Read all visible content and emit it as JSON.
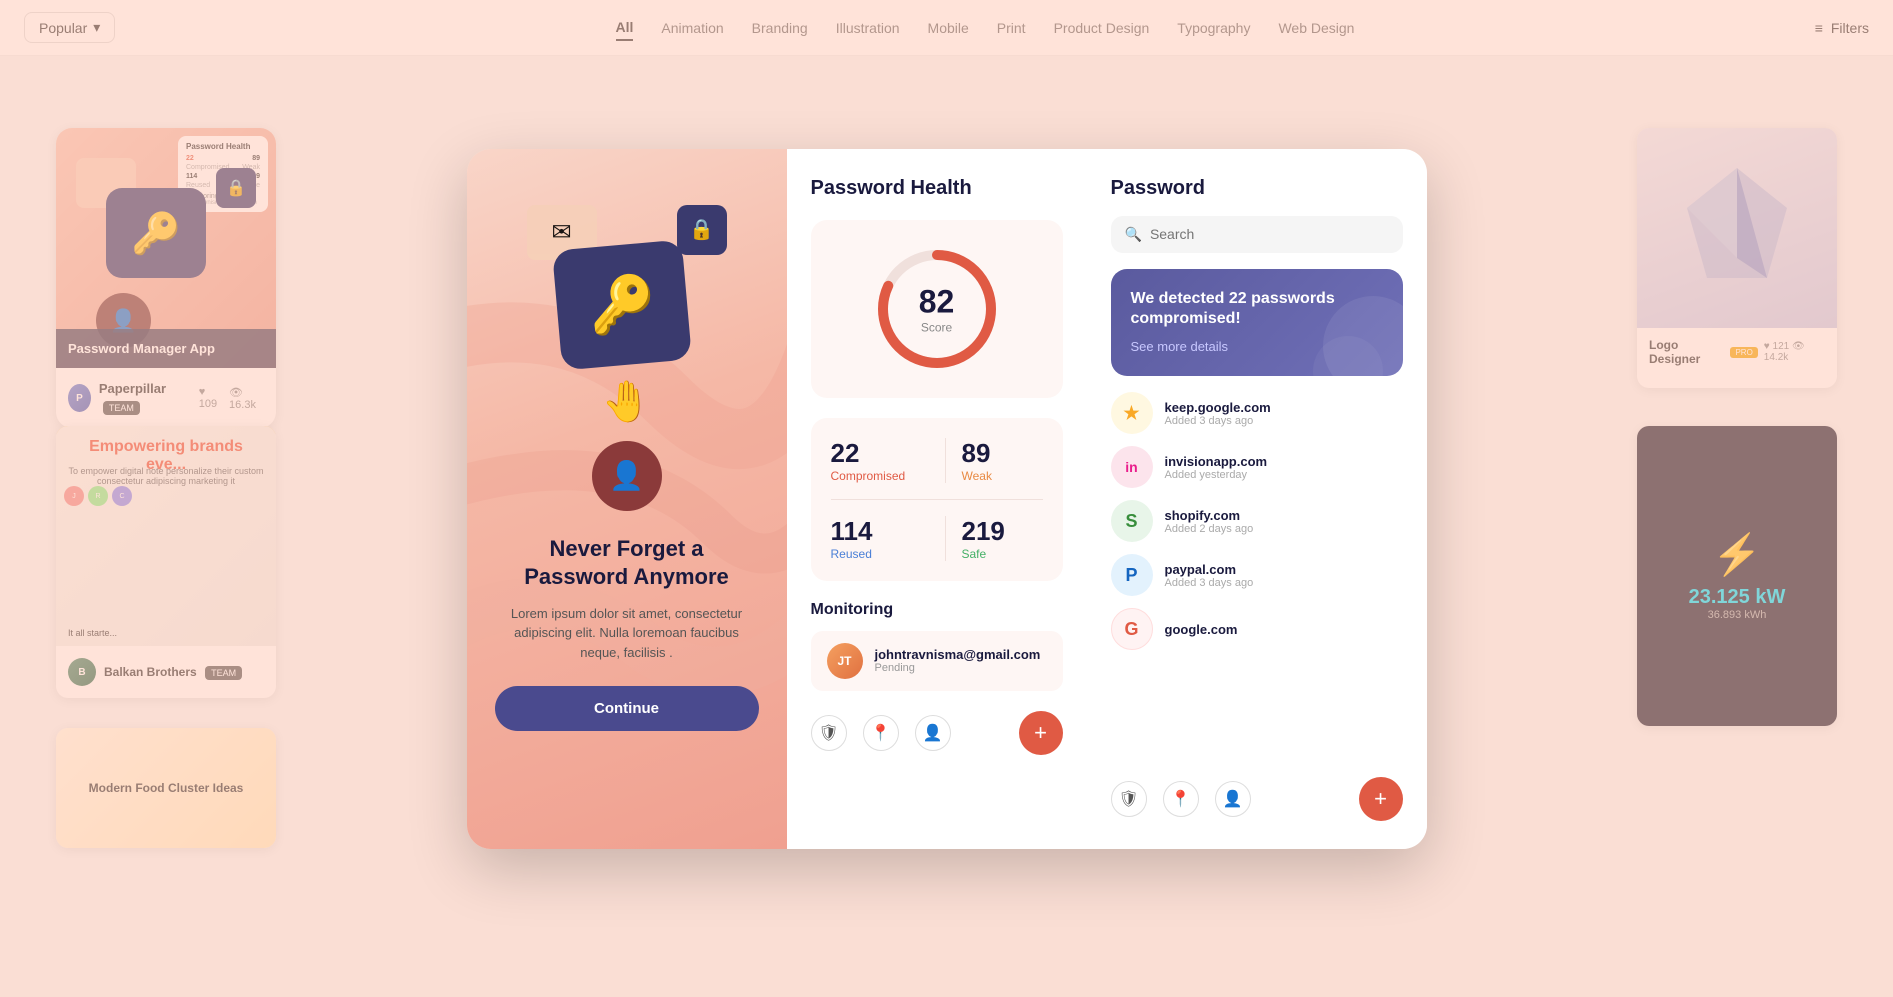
{
  "nav": {
    "popular_label": "Popular",
    "chevron": "▾",
    "filters_label": "Filters",
    "tabs": [
      {
        "label": "All",
        "active": true
      },
      {
        "label": "Animation"
      },
      {
        "label": "Branding"
      },
      {
        "label": "Illustration"
      },
      {
        "label": "Mobile"
      },
      {
        "label": "Print"
      },
      {
        "label": "Product Design"
      },
      {
        "label": "Typography"
      },
      {
        "label": "Web Design"
      }
    ]
  },
  "left_card1": {
    "title": "Password Manager App",
    "author": "Paperpillar",
    "author_initials": "P",
    "team": "TEAM",
    "likes": "109",
    "views": "16.3k",
    "mini_title": "Password Health",
    "stats": [
      {
        "label": "Compromised",
        "val": "22",
        "type": "red"
      },
      {
        "label": "Weak",
        "val": "89",
        "type": "normal"
      },
      {
        "label": "Reused",
        "val": "114",
        "type": "normal"
      },
      {
        "label": "Safe",
        "val": "219",
        "type": "normal"
      }
    ],
    "monitoring_label": "Monitoring"
  },
  "left_card2": {
    "title": "Empowering brands eve...",
    "author": "Balkan Brothers",
    "author_initials": "B",
    "team": "TEAM"
  },
  "left_card3": {
    "title": "Modern Food Cluster Ideas"
  },
  "right_card1": {
    "title": "Logo Designer",
    "badge": "PRO",
    "likes": "121",
    "views": "14.2k"
  },
  "right_card2": {
    "kwh1": "23.125 kW",
    "kwh2": "36.893 kWh"
  },
  "modal": {
    "promo": {
      "title": "Never Forget a Password Anymore",
      "description": "Lorem ipsum dolor sit amet, consectetur adipiscing elit. Nulla loremoan faucibus neque, facilisis .",
      "continue_label": "Continue"
    },
    "health": {
      "title": "Password Health",
      "score": "82",
      "score_label": "Score",
      "stat_compromised": "22",
      "label_compromised": "Compromised",
      "stat_weak": "89",
      "label_weak": "Weak",
      "stat_reused": "114",
      "label_reused": "Reused",
      "stat_safe": "219",
      "label_safe": "Safe",
      "monitoring_title": "Monitoring",
      "email": "johntravnisma@gmail.com",
      "email_initials": "JT",
      "email_status": "Pending"
    },
    "passwords": {
      "title": "Password",
      "search_placeholder": "Search",
      "alert_text": "We detected 22 passwords compromised!",
      "alert_link": "See more details",
      "items": [
        {
          "domain": "keep.google.com",
          "added": "Added 3 days ago",
          "icon_label": "★",
          "icon_class": "pw-icon-keep"
        },
        {
          "domain": "invisionapp.com",
          "added": "Added yesterday",
          "icon_label": "in",
          "icon_class": "pw-icon-inv"
        },
        {
          "domain": "shopify.com",
          "added": "Added 2 days ago",
          "icon_label": "S",
          "icon_class": "pw-icon-shopify"
        },
        {
          "domain": "paypal.com",
          "added": "Added 3 days ago",
          "icon_label": "P",
          "icon_class": "pw-icon-paypal"
        },
        {
          "domain": "google.com",
          "added": "",
          "icon_label": "G",
          "icon_class": "pw-icon-google"
        }
      ]
    }
  }
}
